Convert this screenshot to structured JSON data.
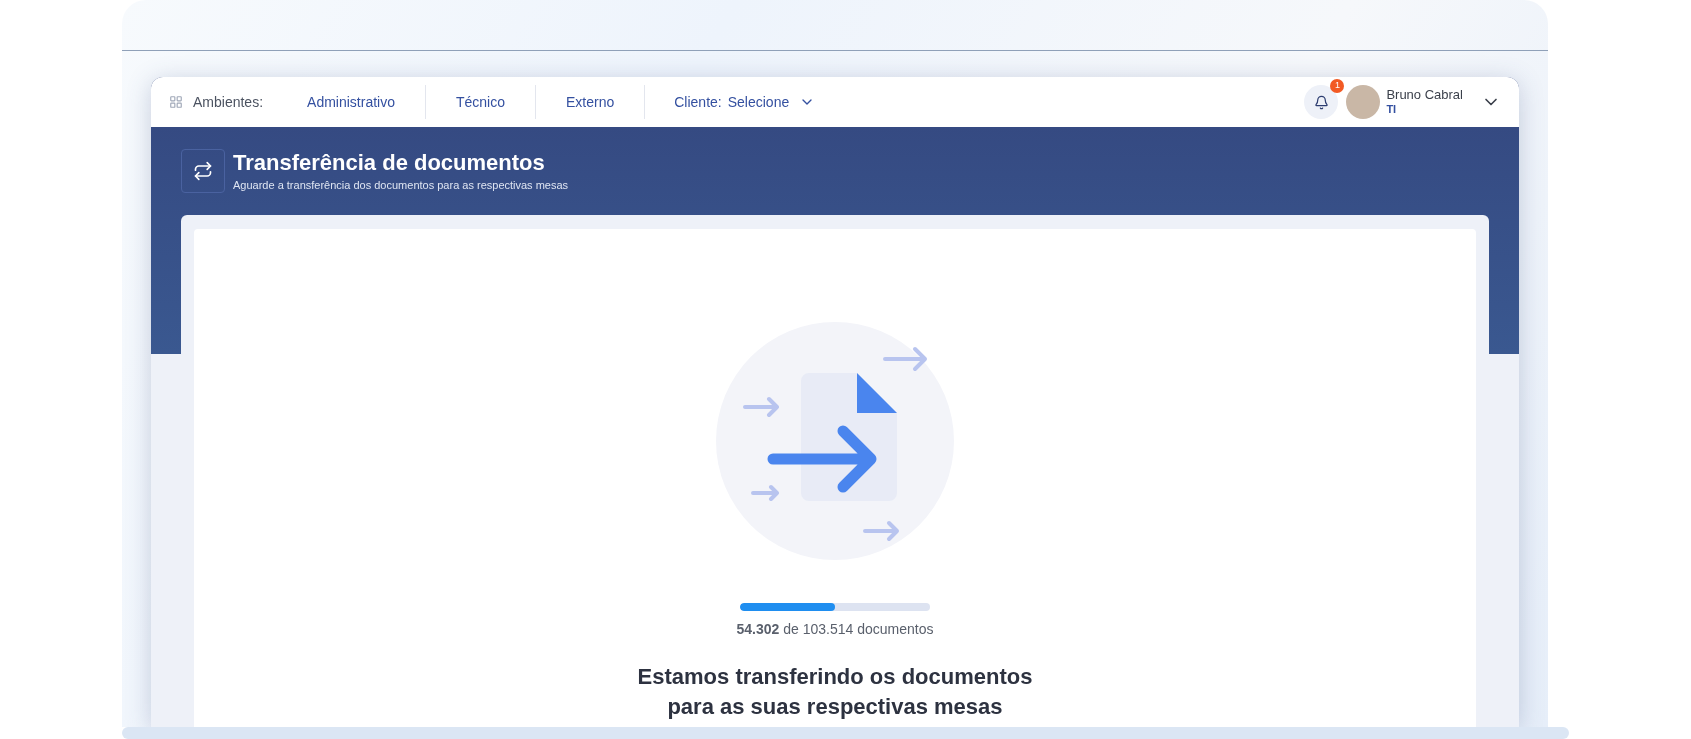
{
  "nav": {
    "environments_label": "Ambientes:",
    "environments": [
      {
        "label": "Administrativo"
      },
      {
        "label": "Técnico"
      },
      {
        "label": "Externo"
      }
    ],
    "client_label": "Cliente:",
    "client_value": "Selecione"
  },
  "notifications": {
    "count": "1"
  },
  "user": {
    "name": "Bruno Cabral",
    "role": "TI"
  },
  "header": {
    "title": "Transferência de documentos",
    "subtitle": "Aguarde a transferência dos documentos para as respectivas mesas"
  },
  "progress": {
    "level": 0.5,
    "caption": "**54.302** de 103.514 documentos"
  },
  "message": {
    "title_lines": [
      "Estamos transferindo os documentos",
      "para as suas respectivas mesas"
    ]
  }
}
